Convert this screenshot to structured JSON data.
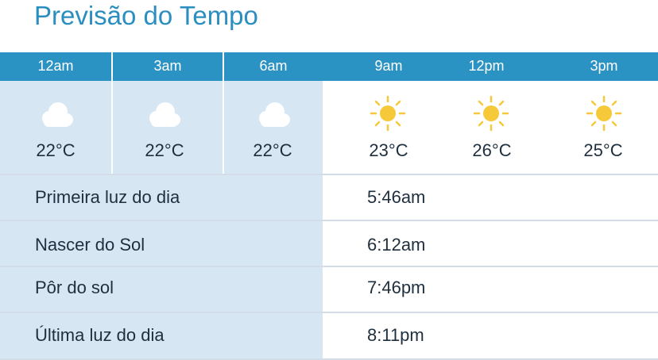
{
  "title": "Previsão do Tempo",
  "forecast": [
    {
      "time": "12am",
      "icon": "cloud-icon",
      "temp": "22°C"
    },
    {
      "time": "3am",
      "icon": "cloud-icon",
      "temp": "22°C"
    },
    {
      "time": "6am",
      "icon": "cloud-icon",
      "temp": "22°C"
    },
    {
      "time": "9am",
      "icon": "sun-icon",
      "temp": "23°C"
    },
    {
      "time": "12pm",
      "icon": "sun-icon",
      "temp": "26°C"
    },
    {
      "time": "3pm",
      "icon": "sun-icon",
      "temp": "25°C"
    }
  ],
  "daylight": [
    {
      "label": "Primeira luz do dia",
      "value": "5:46am"
    },
    {
      "label": "Nascer do Sol",
      "value": "6:12am"
    },
    {
      "label": "Pôr do sol",
      "value": "7:46pm"
    },
    {
      "label": "Última luz do dia",
      "value": "8:11pm"
    }
  ],
  "colors": {
    "title": "#2a8ec0",
    "header_bar": "#2b93c4",
    "shade": "#d6e6f3",
    "sun": "#f5c93a",
    "cloud": "#ffffff",
    "text": "#1f2f3e"
  }
}
